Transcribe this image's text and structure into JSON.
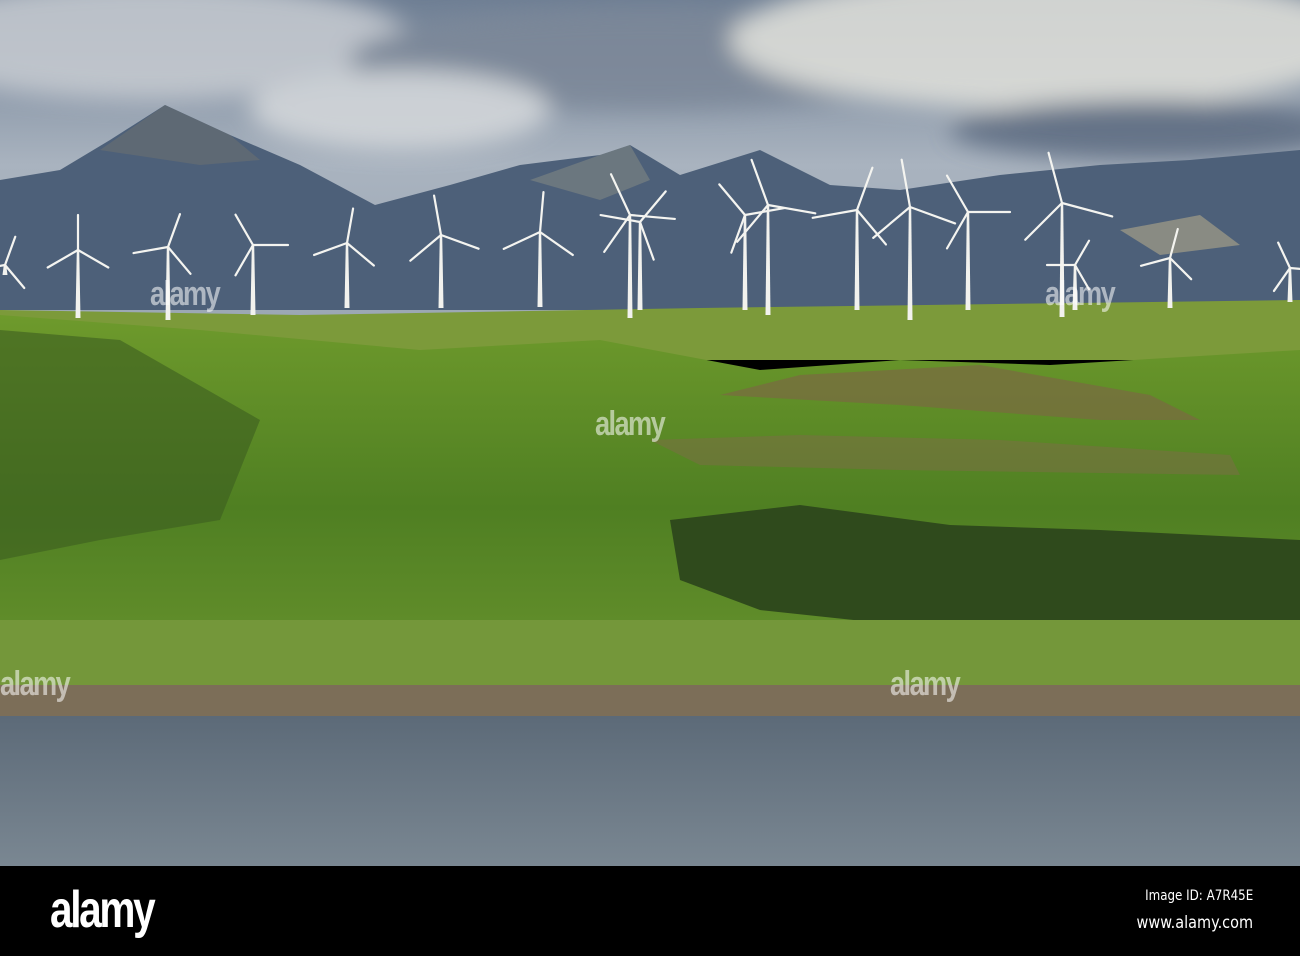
{
  "image": {
    "subject": "wind turbines",
    "watermark_text": "alamy"
  },
  "footer": {
    "logo": "alamy",
    "image_id": "Image ID: A7R45E",
    "url": "www.alamy.com"
  },
  "colors": {
    "sky": "#8a97a6",
    "mountain": "#4a5e78",
    "grass": "#5f8a2a",
    "water": "#6b7884",
    "footer": "#000000"
  }
}
